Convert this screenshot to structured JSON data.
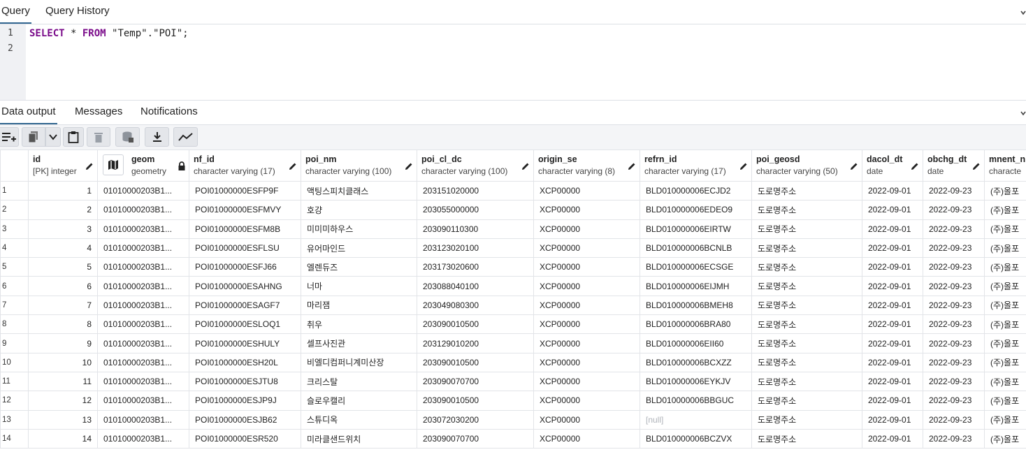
{
  "top_tabs": [
    "Query",
    "Query History"
  ],
  "editor": {
    "line_numbers": [
      "1",
      "2"
    ],
    "kw_select": "SELECT",
    "star": " * ",
    "kw_from": "FROM",
    "target": " \"Temp\".\"POI\";"
  },
  "bottom_tabs": [
    "Data output",
    "Messages",
    "Notifications"
  ],
  "toolbar_icons": [
    "add-row-icon",
    "copy-icon",
    "chevron-down-icon",
    "paste-icon",
    "delete-icon",
    "save-data-icon",
    "download-icon",
    "graph-icon"
  ],
  "columns": [
    {
      "name": "id",
      "type": "[PK] integer",
      "icon": "pencil-icon"
    },
    {
      "name": "geom",
      "type": "geometry",
      "icon": "lock-icon"
    },
    {
      "name": "nf_id",
      "type": "character varying (17)",
      "icon": "pencil-icon"
    },
    {
      "name": "poi_nm",
      "type": "character varying (100)",
      "icon": "pencil-icon"
    },
    {
      "name": "poi_cl_dc",
      "type": "character varying (100)",
      "icon": "pencil-icon"
    },
    {
      "name": "origin_se",
      "type": "character varying (8)",
      "icon": "pencil-icon"
    },
    {
      "name": "refrn_id",
      "type": "character varying (17)",
      "icon": "pencil-icon"
    },
    {
      "name": "poi_geosd",
      "type": "character varying (50)",
      "icon": "pencil-icon"
    },
    {
      "name": "dacol_dt",
      "type": "date",
      "icon": "pencil-icon"
    },
    {
      "name": "obchg_dt",
      "type": "date",
      "icon": "pencil-icon"
    },
    {
      "name": "mnent_n",
      "type": "characte",
      "icon": ""
    }
  ],
  "rows": [
    [
      "1",
      "1",
      "01010000203B1...",
      "POI01000000ESFP9F",
      "액팅스피치클래스",
      "203151020000",
      "XCP00000",
      "BLD010000006ECJD2",
      "도로명주소",
      "2022-09-01",
      "2022-09-23",
      "(주)올포"
    ],
    [
      "2",
      "2",
      "01010000203B1...",
      "POI01000000ESFMVY",
      "호걍",
      "203055000000",
      "XCP00000",
      "BLD010000006EDEO9",
      "도로명주소",
      "2022-09-01",
      "2022-09-23",
      "(주)올포"
    ],
    [
      "3",
      "3",
      "01010000203B1...",
      "POI01000000ESFM8B",
      "미미미하우스",
      "203090110300",
      "XCP00000",
      "BLD010000006EIRTW",
      "도로명주소",
      "2022-09-01",
      "2022-09-23",
      "(주)올포"
    ],
    [
      "4",
      "4",
      "01010000203B1...",
      "POI01000000ESFLSU",
      "유어마인드",
      "203123020100",
      "XCP00000",
      "BLD010000006BCNLB",
      "도로명주소",
      "2022-09-01",
      "2022-09-23",
      "(주)올포"
    ],
    [
      "5",
      "5",
      "01010000203B1...",
      "POI01000000ESFJ66",
      "엘렌듀즈",
      "203173020600",
      "XCP00000",
      "BLD010000006ECSGE",
      "도로명주소",
      "2022-09-01",
      "2022-09-23",
      "(주)올포"
    ],
    [
      "6",
      "6",
      "01010000203B1...",
      "POI01000000ESAHNG",
      "너마",
      "203088040100",
      "XCP00000",
      "BLD010000006EIJMH",
      "도로명주소",
      "2022-09-01",
      "2022-09-23",
      "(주)올포"
    ],
    [
      "7",
      "7",
      "01010000203B1...",
      "POI01000000ESAGF7",
      "마리잼",
      "203049080300",
      "XCP00000",
      "BLD010000006BMEH8",
      "도로명주소",
      "2022-09-01",
      "2022-09-23",
      "(주)올포"
    ],
    [
      "8",
      "8",
      "01010000203B1...",
      "POI01000000ESLOQ1",
      "취우",
      "203090010500",
      "XCP00000",
      "BLD010000006BRA80",
      "도로명주소",
      "2022-09-01",
      "2022-09-23",
      "(주)올포"
    ],
    [
      "9",
      "9",
      "01010000203B1...",
      "POI01000000ESHULY",
      "셀프사진관",
      "203129010200",
      "XCP00000",
      "BLD010000006EII60",
      "도로명주소",
      "2022-09-01",
      "2022-09-23",
      "(주)올포"
    ],
    [
      "10",
      "10",
      "01010000203B1...",
      "POI01000000ESH20L",
      "비엘디컴퍼니계미산장",
      "203090010500",
      "XCP00000",
      "BLD010000006BCXZZ",
      "도로명주소",
      "2022-09-01",
      "2022-09-23",
      "(주)올포"
    ],
    [
      "11",
      "11",
      "01010000203B1...",
      "POI01000000ESJTU8",
      "크리스탈",
      "203090070700",
      "XCP00000",
      "BLD010000006EYKJV",
      "도로명주소",
      "2022-09-01",
      "2022-09-23",
      "(주)올포"
    ],
    [
      "12",
      "12",
      "01010000203B1...",
      "POI01000000ESJP9J",
      "슬로우캘리",
      "203090010500",
      "XCP00000",
      "BLD010000006BBGUC",
      "도로명주소",
      "2022-09-01",
      "2022-09-23",
      "(주)올포"
    ],
    [
      "13",
      "13",
      "01010000203B1...",
      "POI01000000ESJB62",
      "스튜디옥",
      "203072030200",
      "XCP00000",
      "[null]",
      "도로명주소",
      "2022-09-01",
      "2022-09-23",
      "(주)올포"
    ],
    [
      "14",
      "14",
      "01010000203B1...",
      "POI01000000ESR520",
      "미라클샌드위치",
      "203090070700",
      "XCP00000",
      "BLD010000006BCZVX",
      "도로명주소",
      "2022-09-01",
      "2022-09-23",
      "(주)올포"
    ]
  ]
}
